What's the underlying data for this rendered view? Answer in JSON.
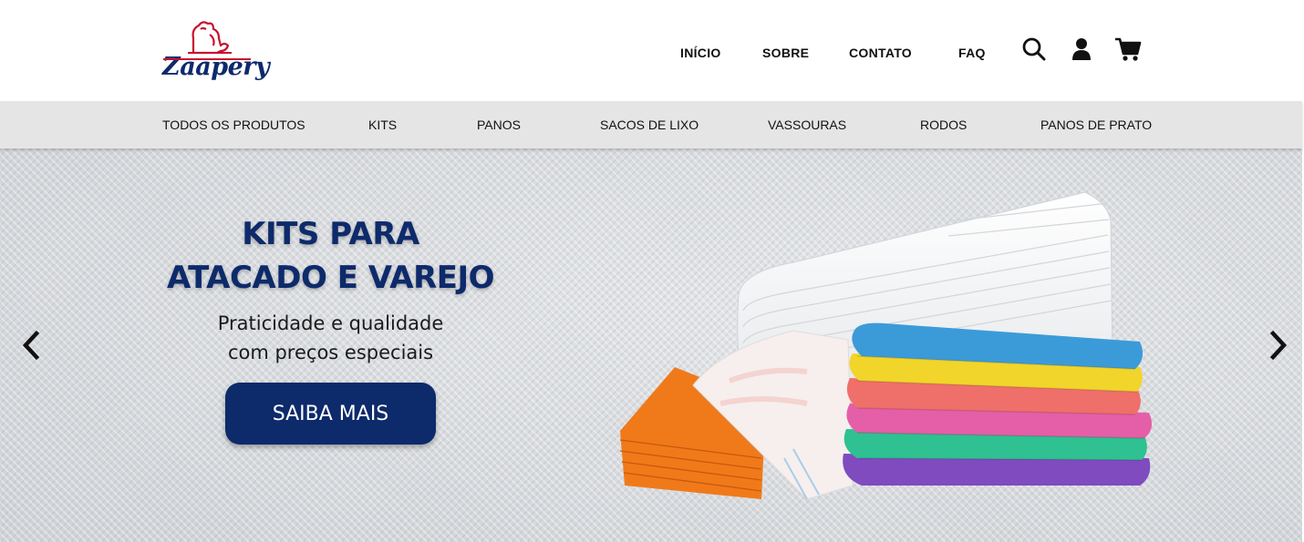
{
  "brand": {
    "name": "Zaapery",
    "logo_icon": "lion-icon",
    "color": "#0d2a6b",
    "accent": "#c8102e"
  },
  "top_nav": {
    "items": [
      {
        "label": "INÍCIO"
      },
      {
        "label": "SOBRE"
      },
      {
        "label": "CONTATO"
      },
      {
        "label": "FAQ"
      }
    ],
    "icons": [
      "search-icon",
      "user-icon",
      "cart-icon"
    ]
  },
  "categories": [
    {
      "label": "TODOS OS PRODUTOS"
    },
    {
      "label": "KITS"
    },
    {
      "label": "PANOS"
    },
    {
      "label": "SACOS DE LIXO"
    },
    {
      "label": "VASSOURAS"
    },
    {
      "label": "RODOS"
    },
    {
      "label": "PANOS DE PRATO"
    }
  ],
  "hero": {
    "title_line1": "KITS PARA",
    "title_line2": "ATACADO E VAREJO",
    "subtitle_line1": "Praticidade e qualidade",
    "subtitle_line2": "com preços especiais",
    "cta_label": "SAIBA MAIS",
    "prev_icon": "chevron-left-icon",
    "next_icon": "chevron-right-icon",
    "product_colors": [
      "#ffffff",
      "#f07a1a",
      "#3b9bd8",
      "#f2d52a",
      "#ef6f6a",
      "#e45fa7",
      "#2fc191",
      "#7f4bbf"
    ]
  }
}
